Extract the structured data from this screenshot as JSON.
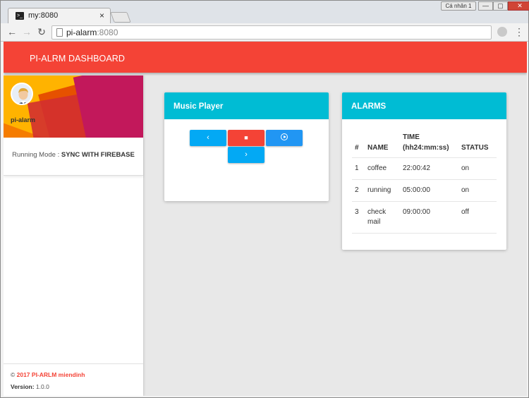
{
  "browser": {
    "tab_title": "my:8080",
    "tab_close": "×",
    "profile_label": "Cá nhân 1",
    "win_min": "—",
    "win_max": "▢",
    "win_close": "✕",
    "nav_back": "←",
    "nav_forward": "→",
    "nav_reload": "↻",
    "url_host": "pi-alarm",
    "url_port": ":8080",
    "menu": "⋮"
  },
  "app": {
    "title": "PI-ALRM DASHBOARD"
  },
  "sidebar": {
    "user_name": "pi-alarm",
    "mode_label": "Running Mode : ",
    "mode_value": "SYNC WITH FIREBASE",
    "footer_copy_symbol": "© ",
    "footer_copy": "2017 PI-ARLM miendinh",
    "footer_version_label": "Version:",
    "footer_version": " 1.0.0"
  },
  "player": {
    "title": "Music Player",
    "prev_label": "‹",
    "stop_label": "■",
    "next_label": "›"
  },
  "alarms": {
    "title": "ALARMS",
    "headers": [
      "#",
      "NAME",
      "TIME (hh24:mm:ss)",
      "STATUS"
    ],
    "rows": [
      {
        "num": "1",
        "name": "coffee",
        "time": "22:00:42",
        "status": "on"
      },
      {
        "num": "2",
        "name": "running",
        "time": "05:00:00",
        "status": "on"
      },
      {
        "num": "3",
        "name": "check mail",
        "time": "09:00:00",
        "status": "off"
      }
    ]
  },
  "colors": {
    "primary": "#f44336",
    "card_header": "#00bcd4",
    "button_blue": "#03a9f4"
  },
  "icons": [
    "terminal-icon",
    "close-icon",
    "back-icon",
    "forward-icon",
    "reload-icon",
    "page-icon",
    "extension-icon",
    "menu-icon",
    "prev-icon",
    "stop-icon",
    "play-circle-icon",
    "next-icon"
  ]
}
